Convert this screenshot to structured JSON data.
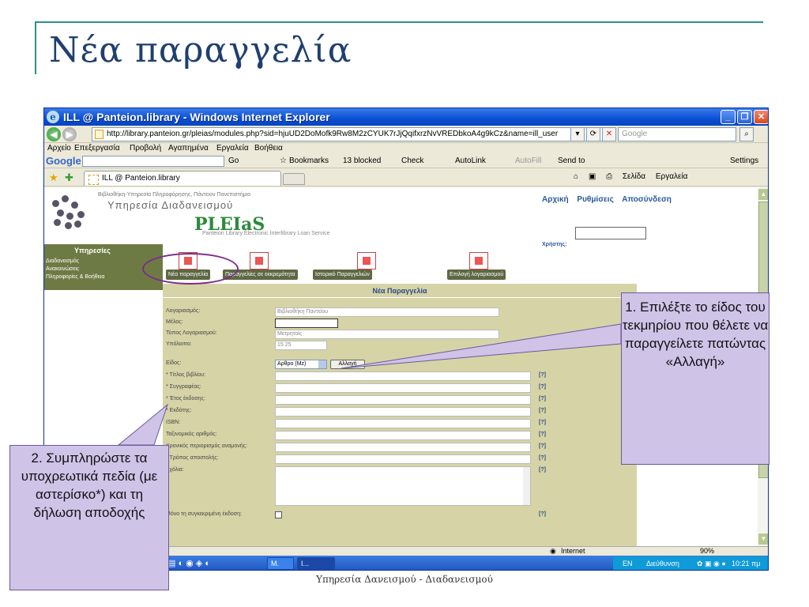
{
  "slide": {
    "title": "Νέα παραγγελία",
    "footer": "Υπηρεσία Δανεισμού - Διαδανεισμού"
  },
  "browser": {
    "window_title": "ILL @ Panteion.library - Windows Internet Explorer",
    "url": "http://library.panteion.gr/pleias/modules.php?sid=hjuUD2DoMofk9Rw8M2zCYUK7rJjQqifxrzNvVREDbkoA4g9kCz&name=ill_user",
    "search_placeholder": "Google",
    "menu": [
      "Αρχείο",
      "Επεξεργασία",
      "Προβολή",
      "Αγαπημένα",
      "Εργαλεία",
      "Βοήθεια"
    ],
    "google_toolbar": {
      "logo": "Google G",
      "go": "Go",
      "bookmarks": "Bookmarks",
      "blocked": "13 blocked",
      "check": "Check",
      "autolink": "AutoLink",
      "autofill": "AutoFill",
      "send_to": "Send to",
      "settings": "Settings"
    },
    "tab_label": "ILL @ Panteion.library",
    "tab_tools": [
      "Σελίδα",
      "Εργαλεία"
    ],
    "status": {
      "zone": "Internet",
      "zoom": "90%"
    }
  },
  "page": {
    "lib_small": "Βιβλιοθήκη-Υπηρεσία Πληροφόρησης, Πάντειον Πανεπιστήμιο",
    "lib_big": "Υπηρεσία Διαδανεισμού",
    "brand": "PLEIaS",
    "brand_sub": "Panteion Library Electronic Interlibrary Loan Service",
    "top_links": [
      "Αρχική",
      "Ρυθμίσεις",
      "Αποσύνδεση"
    ],
    "user_label": "Χρήστης:",
    "sidebar": {
      "heading": "Υπηρεσίες",
      "items": [
        "Διαδανεισμός",
        "Ανακοινώσεις",
        "Πληροφορίες & Βοήθεια"
      ]
    },
    "tabs": [
      "Νέα παραγγελία",
      "Παραγγελίες σε εκκρεμότητα",
      "Ιστορικό Παραγγελιών",
      "Επιλογή λογαριασμού"
    ],
    "form": {
      "title": "Νέα Παραγγελία",
      "account_label": "Λογαριασμός:",
      "account_value": "Βιβλιοθήκη Παντείου",
      "member_label": "Μέλος:",
      "account_type_label": "Τύπος Λογαριασμού:",
      "account_type_value": "Μετρητοίς",
      "balance_label": "Υπόλοιπο:",
      "balance_value": "15.25",
      "kind_label": "Είδος:",
      "kind_value": "Αρθρο (Mz)",
      "change_button": "Αλλαγή",
      "help": "[?]",
      "fields": [
        "* Τίτλος βιβλίου:",
        "* Συγγραφέας:",
        "* Έτος έκδοσης:",
        "* Εκδότης:",
        "ISBN:",
        "Ταξινομικός αριθμός:",
        "Χρονικός περιορισμός αναμονής:",
        "* Τρόπος αποστολής:"
      ],
      "comments_label": "Σχόλια:",
      "only_edition_label": "Μόνο τη συγκεκριμένη έκδοση:"
    }
  },
  "taskbar": {
    "buttons": [
      "M.",
      "I..."
    ],
    "lang": "EN",
    "address": "Διεύθυνση",
    "clock": "10:21 πμ"
  },
  "annotations": {
    "callout_1": "1. Επιλέξτε το είδος του τεκμηρίου που θέλετε να παραγγείλετε πατώντας «Αλλαγή»",
    "callout_2": "2. Συμπληρώστε τα υποχρεωτικά πεδία (με αστερίσκο*) και τη δήλωση αποδοχής"
  },
  "colors": {
    "accent_line": "#2f8f8f",
    "title": "#1f3f6f",
    "callout_fill": "#cfc3e8",
    "ellipse": "#7b2c8a",
    "form_panel": "#d6d4a6",
    "sidebar": "#6e7a44"
  }
}
